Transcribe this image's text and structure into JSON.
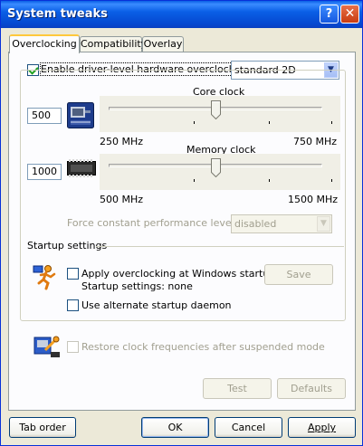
{
  "window": {
    "title": "System tweaks"
  },
  "tabs": [
    {
      "label": "Overclocking"
    },
    {
      "label": "Compatibility"
    },
    {
      "label": "Overlay"
    }
  ],
  "overclocking": {
    "enable_label": "Enable driver-level hardware overclocking",
    "enable_checked": true,
    "mode_select": "standard 2D",
    "core_clock": {
      "title": "Core clock",
      "value": "500",
      "min_label": "250 MHz",
      "max_label": "750 MHz",
      "slider_fraction": 0.5
    },
    "memory_clock": {
      "title": "Memory clock",
      "value": "1000",
      "min_label": "500 MHz",
      "max_label": "1500 MHz",
      "slider_fraction": 0.5
    },
    "force_perf_label": "Force constant performance level",
    "force_perf_select": "disabled",
    "startup": {
      "title": "Startup settings",
      "apply_label": "Apply overclocking at Windows startup",
      "startup_settings_text": "Startup settings: none",
      "save_label": "Save",
      "alt_daemon_label": "Use alternate startup daemon"
    },
    "restore_label": "Restore clock frequencies after suspended mode",
    "test_label": "Test",
    "defaults_label": "Defaults"
  },
  "footer": {
    "tab_order_label": "Tab order",
    "ok_label": "OK",
    "cancel_label": "Cancel",
    "apply_label": "Apply"
  },
  "colors": {
    "titlebar": "#0A5FE6",
    "dialog_bg": "#ECE9D8",
    "panel_bg": "#FCFCFE",
    "tab_highlight": "#FFC83C"
  }
}
